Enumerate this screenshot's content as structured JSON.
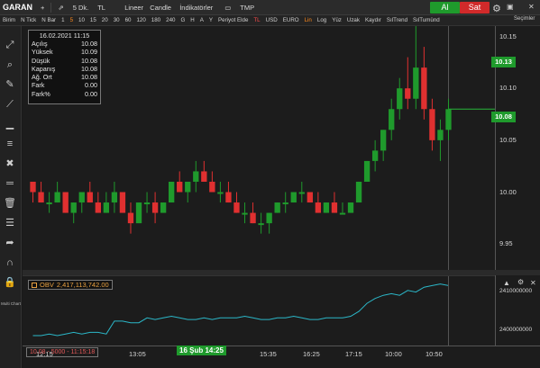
{
  "toolbar": {
    "symbol": "GARAN",
    "period": "5 Dk.",
    "currency": "TL",
    "scale": "Lineer",
    "chart_type": "Candle",
    "indicators": "İndikatörler",
    "template": "TMP",
    "buy_label": "Al",
    "sell_label": "Sat"
  },
  "toolbar2": {
    "items": [
      "Birim",
      "N Tick",
      "N Bar",
      "1",
      "5",
      "10",
      "15",
      "20",
      "30",
      "60",
      "120",
      "180",
      "240",
      "G",
      "H",
      "A",
      "Y",
      "Periyot Elde",
      "TL",
      "USD",
      "EURO",
      "Lin",
      "Log",
      "Yüz",
      "Uzak",
      "Kaydır",
      "SılTrend",
      "SılTumünd"
    ]
  },
  "secimler": "Seçimler",
  "info": {
    "datetime": "16.02.2021 11:15",
    "rows": [
      {
        "label": "Açılış",
        "value": "10.08"
      },
      {
        "label": "Yüksek",
        "value": "10.09"
      },
      {
        "label": "Düşük",
        "value": "10.08"
      },
      {
        "label": "Kapanış",
        "value": "10.08"
      },
      {
        "label": "Ağ. Ort",
        "value": "10.08"
      },
      {
        "label": "Fark",
        "value": "0.00"
      },
      {
        "label": "Fark%",
        "value": "0.00"
      }
    ]
  },
  "price_axis": [
    "10.15",
    "10.10",
    "10.05",
    "10.00",
    "9.95"
  ],
  "price_tags": {
    "current": "10.13",
    "last": "10.08"
  },
  "obv": {
    "label": "OBV",
    "value": "2,417,113,742.00"
  },
  "obv_axis": [
    "2410000000",
    "2400000000"
  ],
  "time_axis": [
    "12:15",
    "13:05",
    "15:35",
    "16:25",
    "17:15",
    "10:00",
    "10:50"
  ],
  "cursor_time": "16 Şub 14:25",
  "status": "10.08 - 5000 - 11:15:18",
  "left_tools": {
    "multi_chart": "Multi Chart"
  },
  "chart_data": {
    "type": "candlestick",
    "price_ticks": [
      "10.15",
      "10.10",
      "10.05",
      "10.00",
      "9.95"
    ],
    "candles": [
      [
        10.01,
        10.0,
        9.99,
        10.0
      ],
      [
        10.0,
        10.01,
        9.99,
        9.99
      ],
      [
        9.99,
        10.0,
        9.98,
        9.99
      ],
      [
        9.99,
        10.01,
        9.99,
        10.0
      ],
      [
        10.0,
        10.0,
        9.98,
        9.98
      ],
      [
        9.98,
        9.99,
        9.97,
        9.99
      ],
      [
        9.99,
        10.0,
        9.98,
        10.0
      ],
      [
        10.0,
        10.01,
        9.99,
        9.99
      ],
      [
        9.99,
        10.0,
        9.98,
        9.98
      ],
      [
        9.98,
        10.0,
        9.98,
        9.99
      ],
      [
        9.99,
        10.01,
        9.98,
        10.0
      ],
      [
        10.0,
        10.0,
        9.98,
        9.98
      ],
      [
        9.98,
        9.99,
        9.96,
        9.97
      ],
      [
        9.97,
        9.99,
        9.97,
        9.99
      ],
      [
        9.99,
        10.0,
        9.98,
        9.99
      ],
      [
        9.99,
        10.0,
        9.97,
        9.98
      ],
      [
        9.98,
        9.99,
        9.98,
        9.99
      ],
      [
        9.99,
        10.01,
        9.99,
        10.01
      ],
      [
        10.01,
        10.02,
        10.0,
        10.0
      ],
      [
        10.0,
        10.01,
        9.99,
        10.01
      ],
      [
        10.01,
        10.03,
        10.0,
        10.02
      ],
      [
        10.02,
        10.03,
        10.01,
        10.01
      ],
      [
        10.01,
        10.02,
        10.0,
        10.0
      ],
      [
        10.0,
        10.01,
        9.99,
        10.0
      ],
      [
        10.0,
        10.01,
        9.99,
        9.99
      ],
      [
        9.99,
        10.0,
        9.98,
        9.98
      ],
      [
        9.98,
        9.99,
        9.97,
        9.98
      ],
      [
        9.98,
        9.99,
        9.97,
        9.97
      ],
      [
        9.97,
        9.98,
        9.96,
        9.97
      ],
      [
        9.97,
        9.98,
        9.96,
        9.98
      ],
      [
        9.98,
        9.99,
        9.98,
        9.99
      ],
      [
        9.99,
        10.0,
        9.98,
        9.99
      ],
      [
        9.99,
        10.0,
        9.99,
        10.0
      ],
      [
        10.0,
        10.01,
        9.99,
        10.0
      ],
      [
        10.0,
        10.0,
        9.99,
        9.99
      ],
      [
        9.99,
        10.0,
        9.98,
        9.98
      ],
      [
        9.98,
        9.99,
        9.98,
        9.99
      ],
      [
        9.99,
        10.0,
        9.98,
        9.98
      ],
      [
        9.98,
        9.99,
        9.98,
        9.98
      ],
      [
        9.98,
        9.99,
        9.98,
        9.99
      ],
      [
        9.99,
        10.01,
        9.99,
        10.01
      ],
      [
        10.01,
        10.03,
        10.01,
        10.03
      ],
      [
        10.03,
        10.05,
        10.02,
        10.04
      ],
      [
        10.04,
        10.06,
        10.03,
        10.06
      ],
      [
        10.06,
        10.09,
        10.05,
        10.08
      ],
      [
        10.08,
        10.11,
        10.07,
        10.1
      ],
      [
        10.1,
        10.13,
        10.08,
        10.09
      ],
      [
        10.09,
        10.16,
        10.08,
        10.12
      ],
      [
        10.12,
        10.14,
        10.07,
        10.08
      ],
      [
        10.08,
        10.09,
        10.04,
        10.05
      ],
      [
        10.05,
        10.07,
        10.03,
        10.06
      ],
      [
        10.06,
        10.09,
        10.05,
        10.08
      ]
    ],
    "obv_series": [
      2.3985,
      2.3985,
      2.3986,
      2.3985,
      2.3986,
      2.3987,
      2.3986,
      2.3987,
      2.3987,
      2.3986,
      2.3994,
      2.3994,
      2.3993,
      2.3993,
      2.3996,
      2.3995,
      2.3996,
      2.3997,
      2.3996,
      2.3995,
      2.3995,
      2.3996,
      2.3995,
      2.3996,
      2.3996,
      2.3996,
      2.3997,
      2.3996,
      2.3995,
      2.3995,
      2.3996,
      2.3996,
      2.3997,
      2.3996,
      2.3995,
      2.3995,
      2.3996,
      2.3996,
      2.3996,
      2.3997,
      2.4,
      2.4005,
      2.4008,
      2.401,
      2.4011,
      2.401,
      2.4013,
      2.4012,
      2.4015,
      2.4016,
      2.4017,
      2.4016
    ]
  }
}
